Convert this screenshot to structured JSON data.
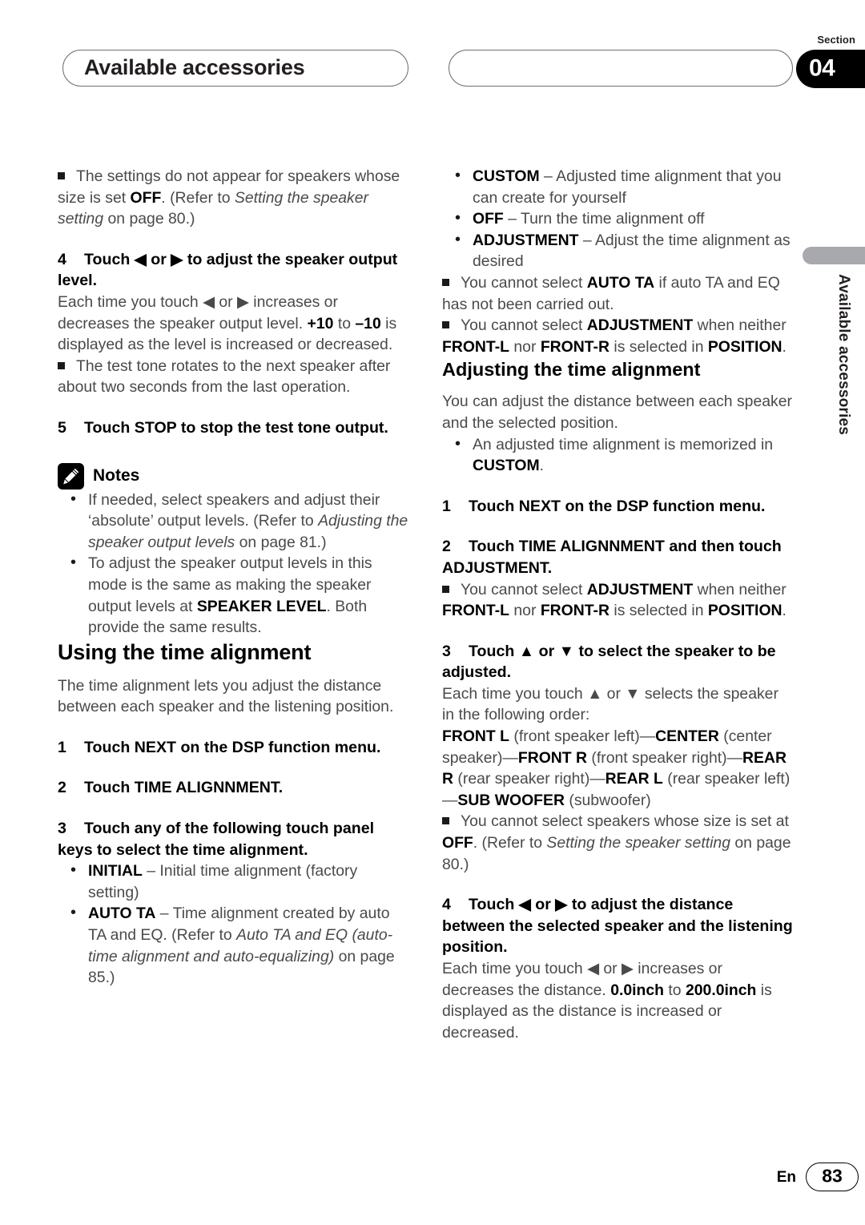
{
  "header": {
    "chapter_title": "Available accessories",
    "section_label": "Section",
    "section_number": "04"
  },
  "side_tab": {
    "text": "Available accessories"
  },
  "left_column": {
    "note_speakers_off": {
      "text_1": "The settings do not appear for speakers whose size is set ",
      "bold_1": "OFF",
      "text_2": ". (Refer to ",
      "italic_1": "Setting the speaker setting",
      "text_3": " on page 80.)"
    },
    "step_4": {
      "num": "4",
      "heading": "Touch ◀ or ▶ to adjust the speaker output level.",
      "body_1": "Each time you touch ◀ or ▶ increases or decreases the speaker output level. ",
      "bold_1": "+10",
      "body_2": " to ",
      "bold_2": "–10",
      "body_3": " is displayed as the level is increased or decreased.",
      "note_1": "The test tone rotates to the next speaker after about two seconds from the last operation."
    },
    "step_5": {
      "num": "5",
      "heading": "Touch STOP to stop the test tone output."
    },
    "notes": {
      "icon": "pencil-icon",
      "title": "Notes",
      "items": [
        {
          "text_1": "If needed, select speakers and adjust their ‘absolute’ output levels. (Refer to ",
          "italic_1": "Adjusting the speaker output levels",
          "text_2": " on page 81.)"
        },
        {
          "text_1": "To adjust the speaker output levels in this mode is the same as making the speaker output levels at ",
          "bold_1": "SPEAKER LEVEL",
          "text_2": ". Both provide the same results."
        }
      ]
    },
    "section_heading": "Using the time alignment",
    "section_intro": "The time alignment lets you adjust the distance between each speaker and the listening position.",
    "step_1": {
      "num": "1",
      "heading": "Touch NEXT on the DSP function menu."
    },
    "step_2": {
      "num": "2",
      "heading": "Touch TIME ALIGNNMENT."
    },
    "step_3": {
      "num": "3",
      "heading": "Touch any of the following touch panel keys to select the time alignment.",
      "options": [
        {
          "bold": "INITIAL",
          "text": " – Initial time alignment (factory setting)"
        },
        {
          "bold": "AUTO TA",
          "text_1": " – Time alignment created by auto TA and EQ. (Refer to ",
          "italic_1": "Auto TA and EQ (auto-time alignment and auto-equalizing)",
          "text_2": " on page 85.)"
        }
      ]
    }
  },
  "right_column": {
    "options_continued": [
      {
        "bold": "CUSTOM",
        "text": " – Adjusted time alignment that you can create for yourself"
      },
      {
        "bold": "OFF",
        "text": " – Turn the time alignment off"
      },
      {
        "bold": "ADJUSTMENT",
        "text": " – Adjust the time alignment as desired"
      }
    ],
    "note_auto_ta": {
      "text_1": "You cannot select ",
      "bold_1": "AUTO TA",
      "text_2": " if auto TA and EQ has not been carried out."
    },
    "note_adjustment_1": {
      "text_1": "You cannot select ",
      "bold_1": "ADJUSTMENT",
      "text_2": " when neither ",
      "bold_2": "FRONT-L",
      "text_3": " nor ",
      "bold_3": "FRONT-R",
      "text_4": " is selected in ",
      "bold_4": "POSITION",
      "text_5": "."
    },
    "section_heading": "Adjusting the time alignment",
    "section_intro": "You can adjust the distance between each speaker and the selected position.",
    "intro_bullet": {
      "text_1": "An adjusted time alignment is memorized in ",
      "bold_1": "CUSTOM",
      "text_2": "."
    },
    "step_1": {
      "num": "1",
      "heading": "Touch NEXT on the DSP function menu."
    },
    "step_2": {
      "num": "2",
      "heading": "Touch TIME ALIGNNMENT and then touch ADJUSTMENT.",
      "note": {
        "text_1": "You cannot select ",
        "bold_1": "ADJUSTMENT",
        "text_2": " when neither ",
        "bold_2": "FRONT-L",
        "text_3": " nor ",
        "bold_3": "FRONT-R",
        "text_4": " is selected in ",
        "bold_4": "POSITION",
        "text_5": "."
      }
    },
    "step_3": {
      "num": "3",
      "heading": "Touch ▲ or ▼ to select the speaker to be adjusted.",
      "body": "Each time you touch ▲ or ▼ selects the speaker in the following order:",
      "order": {
        "b1": "FRONT L",
        "t1": " (front speaker left)—",
        "b2": "CENTER",
        "t2": " (center speaker)—",
        "b3": "FRONT R",
        "t3": " (front speaker right)—",
        "b4": "REAR R",
        "t4": " (rear speaker right)—",
        "b5": "REAR L",
        "t5": " (rear speaker left)—",
        "b6": "SUB WOOFER",
        "t6": " (subwoofer)"
      },
      "note": {
        "text_1": "You cannot select speakers whose size is set at ",
        "bold_1": "OFF",
        "text_2": ". (Refer to ",
        "italic_1": "Setting the speaker setting",
        "text_3": " on page 80.)"
      }
    },
    "step_4": {
      "num": "4",
      "heading": "Touch ◀ or ▶ to adjust the distance between the selected speaker and the listening position.",
      "body_1": "Each time you touch ◀ or ▶ increases or decreases the distance. ",
      "bold_1": "0.0inch",
      "body_2": " to ",
      "bold_2": "200.0inch",
      "body_3": " is displayed as the distance is increased or decreased."
    }
  },
  "footer": {
    "language": "En",
    "page_number": "83"
  }
}
